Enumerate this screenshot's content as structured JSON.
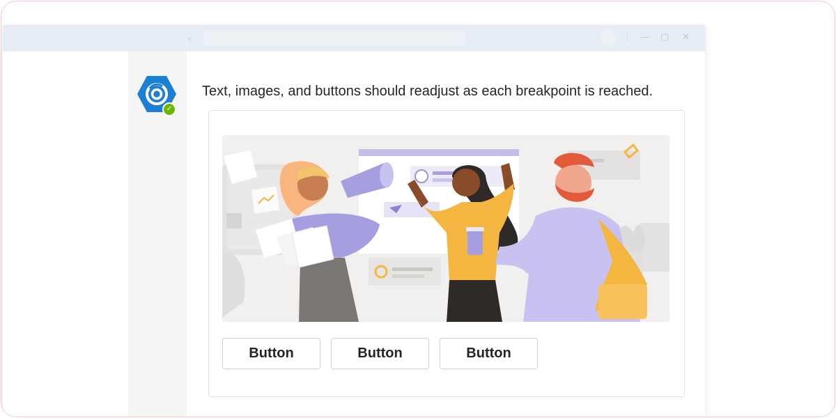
{
  "window": {
    "titlebar_icons": [
      "chevron-left-icon",
      "avatar",
      "more-icon",
      "minimize-icon",
      "maximize-icon",
      "close-icon"
    ],
    "back_glyph": "‹",
    "more_glyph": "⋮",
    "minimize_glyph": "—",
    "maximize_glyph": "▢",
    "close_glyph": "✕"
  },
  "bot": {
    "icon": "hexagon-ring-logo-icon",
    "status_icon": "checkmark-icon",
    "status_glyph": "✓",
    "brand_color": "#0f6cbd",
    "status_color": "#6bb700"
  },
  "message": {
    "text": "Text, images, and buttons should readjust as each breakpoint is reached."
  },
  "card": {
    "image": "team-celebration-illustration",
    "buttons": [
      {
        "label": "Button"
      },
      {
        "label": "Button"
      },
      {
        "label": "Button"
      }
    ]
  }
}
